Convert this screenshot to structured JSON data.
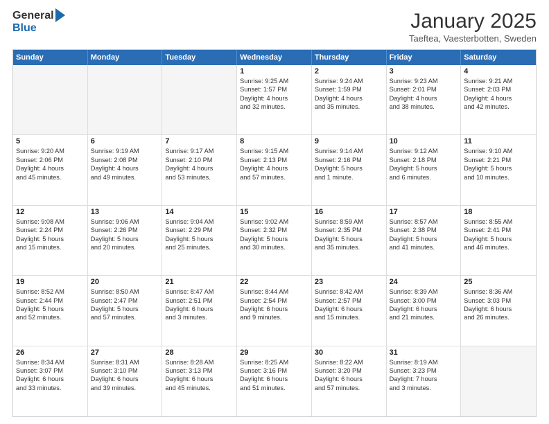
{
  "header": {
    "logo_general": "General",
    "logo_blue": "Blue",
    "title": "January 2025",
    "location": "Taeftea, Vaesterbotten, Sweden"
  },
  "calendar": {
    "days_of_week": [
      "Sunday",
      "Monday",
      "Tuesday",
      "Wednesday",
      "Thursday",
      "Friday",
      "Saturday"
    ],
    "weeks": [
      [
        {
          "day": "",
          "empty": true
        },
        {
          "day": "",
          "empty": true
        },
        {
          "day": "",
          "empty": true
        },
        {
          "day": "1",
          "lines": [
            "Sunrise: 9:25 AM",
            "Sunset: 1:57 PM",
            "Daylight: 4 hours",
            "and 32 minutes."
          ]
        },
        {
          "day": "2",
          "lines": [
            "Sunrise: 9:24 AM",
            "Sunset: 1:59 PM",
            "Daylight: 4 hours",
            "and 35 minutes."
          ]
        },
        {
          "day": "3",
          "lines": [
            "Sunrise: 9:23 AM",
            "Sunset: 2:01 PM",
            "Daylight: 4 hours",
            "and 38 minutes."
          ]
        },
        {
          "day": "4",
          "lines": [
            "Sunrise: 9:21 AM",
            "Sunset: 2:03 PM",
            "Daylight: 4 hours",
            "and 42 minutes."
          ]
        }
      ],
      [
        {
          "day": "5",
          "lines": [
            "Sunrise: 9:20 AM",
            "Sunset: 2:06 PM",
            "Daylight: 4 hours",
            "and 45 minutes."
          ]
        },
        {
          "day": "6",
          "lines": [
            "Sunrise: 9:19 AM",
            "Sunset: 2:08 PM",
            "Daylight: 4 hours",
            "and 49 minutes."
          ]
        },
        {
          "day": "7",
          "lines": [
            "Sunrise: 9:17 AM",
            "Sunset: 2:10 PM",
            "Daylight: 4 hours",
            "and 53 minutes."
          ]
        },
        {
          "day": "8",
          "lines": [
            "Sunrise: 9:15 AM",
            "Sunset: 2:13 PM",
            "Daylight: 4 hours",
            "and 57 minutes."
          ]
        },
        {
          "day": "9",
          "lines": [
            "Sunrise: 9:14 AM",
            "Sunset: 2:16 PM",
            "Daylight: 5 hours",
            "and 1 minute."
          ]
        },
        {
          "day": "10",
          "lines": [
            "Sunrise: 9:12 AM",
            "Sunset: 2:18 PM",
            "Daylight: 5 hours",
            "and 6 minutes."
          ]
        },
        {
          "day": "11",
          "lines": [
            "Sunrise: 9:10 AM",
            "Sunset: 2:21 PM",
            "Daylight: 5 hours",
            "and 10 minutes."
          ]
        }
      ],
      [
        {
          "day": "12",
          "lines": [
            "Sunrise: 9:08 AM",
            "Sunset: 2:24 PM",
            "Daylight: 5 hours",
            "and 15 minutes."
          ]
        },
        {
          "day": "13",
          "lines": [
            "Sunrise: 9:06 AM",
            "Sunset: 2:26 PM",
            "Daylight: 5 hours",
            "and 20 minutes."
          ]
        },
        {
          "day": "14",
          "lines": [
            "Sunrise: 9:04 AM",
            "Sunset: 2:29 PM",
            "Daylight: 5 hours",
            "and 25 minutes."
          ]
        },
        {
          "day": "15",
          "lines": [
            "Sunrise: 9:02 AM",
            "Sunset: 2:32 PM",
            "Daylight: 5 hours",
            "and 30 minutes."
          ]
        },
        {
          "day": "16",
          "lines": [
            "Sunrise: 8:59 AM",
            "Sunset: 2:35 PM",
            "Daylight: 5 hours",
            "and 35 minutes."
          ]
        },
        {
          "day": "17",
          "lines": [
            "Sunrise: 8:57 AM",
            "Sunset: 2:38 PM",
            "Daylight: 5 hours",
            "and 41 minutes."
          ]
        },
        {
          "day": "18",
          "lines": [
            "Sunrise: 8:55 AM",
            "Sunset: 2:41 PM",
            "Daylight: 5 hours",
            "and 46 minutes."
          ]
        }
      ],
      [
        {
          "day": "19",
          "lines": [
            "Sunrise: 8:52 AM",
            "Sunset: 2:44 PM",
            "Daylight: 5 hours",
            "and 52 minutes."
          ]
        },
        {
          "day": "20",
          "lines": [
            "Sunrise: 8:50 AM",
            "Sunset: 2:47 PM",
            "Daylight: 5 hours",
            "and 57 minutes."
          ]
        },
        {
          "day": "21",
          "lines": [
            "Sunrise: 8:47 AM",
            "Sunset: 2:51 PM",
            "Daylight: 6 hours",
            "and 3 minutes."
          ]
        },
        {
          "day": "22",
          "lines": [
            "Sunrise: 8:44 AM",
            "Sunset: 2:54 PM",
            "Daylight: 6 hours",
            "and 9 minutes."
          ]
        },
        {
          "day": "23",
          "lines": [
            "Sunrise: 8:42 AM",
            "Sunset: 2:57 PM",
            "Daylight: 6 hours",
            "and 15 minutes."
          ]
        },
        {
          "day": "24",
          "lines": [
            "Sunrise: 8:39 AM",
            "Sunset: 3:00 PM",
            "Daylight: 6 hours",
            "and 21 minutes."
          ]
        },
        {
          "day": "25",
          "lines": [
            "Sunrise: 8:36 AM",
            "Sunset: 3:03 PM",
            "Daylight: 6 hours",
            "and 26 minutes."
          ]
        }
      ],
      [
        {
          "day": "26",
          "lines": [
            "Sunrise: 8:34 AM",
            "Sunset: 3:07 PM",
            "Daylight: 6 hours",
            "and 33 minutes."
          ]
        },
        {
          "day": "27",
          "lines": [
            "Sunrise: 8:31 AM",
            "Sunset: 3:10 PM",
            "Daylight: 6 hours",
            "and 39 minutes."
          ]
        },
        {
          "day": "28",
          "lines": [
            "Sunrise: 8:28 AM",
            "Sunset: 3:13 PM",
            "Daylight: 6 hours",
            "and 45 minutes."
          ]
        },
        {
          "day": "29",
          "lines": [
            "Sunrise: 8:25 AM",
            "Sunset: 3:16 PM",
            "Daylight: 6 hours",
            "and 51 minutes."
          ]
        },
        {
          "day": "30",
          "lines": [
            "Sunrise: 8:22 AM",
            "Sunset: 3:20 PM",
            "Daylight: 6 hours",
            "and 57 minutes."
          ]
        },
        {
          "day": "31",
          "lines": [
            "Sunrise: 8:19 AM",
            "Sunset: 3:23 PM",
            "Daylight: 7 hours",
            "and 3 minutes."
          ]
        },
        {
          "day": "",
          "empty": true
        }
      ]
    ]
  }
}
